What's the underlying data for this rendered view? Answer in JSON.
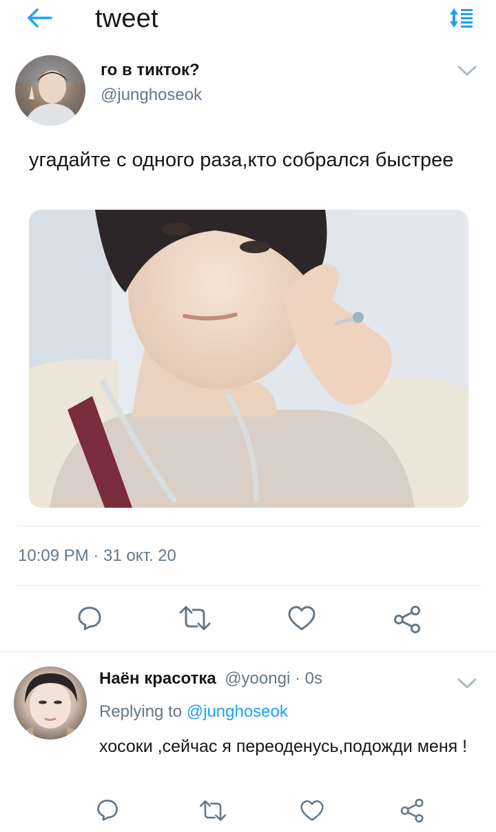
{
  "header": {
    "title": "tweet",
    "back_icon": "arrow-left-icon",
    "sort_icon": "sort-icon",
    "accent_color": "#1da1f2"
  },
  "tweet": {
    "display_name": "го в тикток?",
    "handle": "@junghoseok",
    "text": "угадайте с одного раза,кто собрался быстрее",
    "timestamp": "10:09 PM · 31 окт. 20",
    "actions": [
      "reply-icon",
      "retweet-icon",
      "like-icon",
      "share-icon"
    ]
  },
  "reply": {
    "display_name": "Наён красотка",
    "handle": "@yoongi",
    "time": " · 0s",
    "replying_prefix": "Replying to ",
    "replying_to": "@junghoseok",
    "text": "хосоки ,сейчас я переоденусь,подожди меня !",
    "actions": [
      "reply-icon",
      "retweet-icon",
      "like-icon",
      "share-icon"
    ]
  }
}
